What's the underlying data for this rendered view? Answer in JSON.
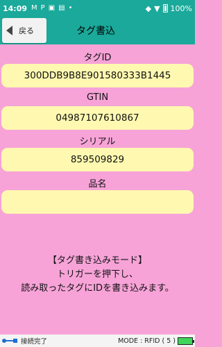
{
  "statusbar": {
    "time": "14:09",
    "notification_icons": [
      "gmail-icon",
      "p-icon",
      "parking-icon",
      "gallery-icon"
    ],
    "battery_percent": "100%"
  },
  "header": {
    "back_label": "戻る",
    "title": "タグ書込"
  },
  "fields": [
    {
      "label": "タグID",
      "value": "300DDB9B8E901580333B1445"
    },
    {
      "label": "GTIN",
      "value": "04987107610867"
    },
    {
      "label": "シリアル",
      "value": "859509829"
    },
    {
      "label": "品名",
      "value": ""
    }
  ],
  "message": {
    "line1": "【タグ書き込みモード】",
    "line2": "トリガーを押下し、",
    "line3": "読み取ったタグにIDを書き込みます。"
  },
  "bottom": {
    "connection_status": "接続完了",
    "mode_text": "MODE : RFID ( 5 )"
  },
  "colors": {
    "header": "#1aa99a",
    "background": "#f7a3d8",
    "field": "#fff8b0",
    "battery": "#3fd55c"
  }
}
